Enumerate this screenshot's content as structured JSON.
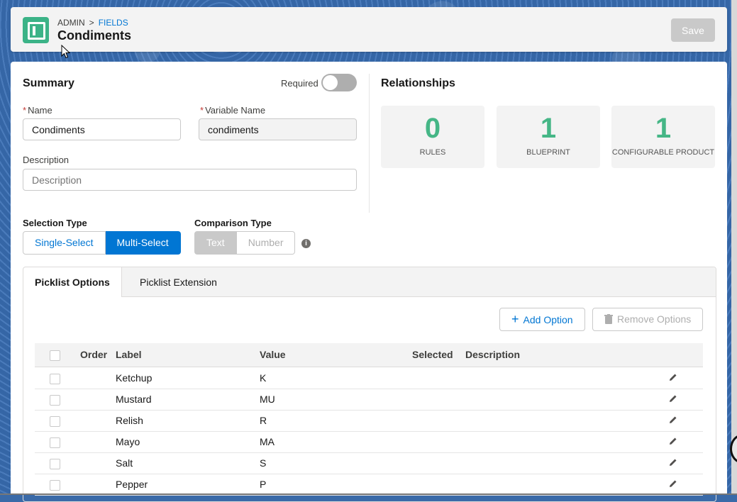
{
  "header": {
    "breadcrumb_root": "ADMIN",
    "breadcrumb_sep": ">",
    "breadcrumb_link": "FIELDS",
    "title": "Condiments",
    "save_label": "Save"
  },
  "summary": {
    "title": "Summary",
    "required_label": "Required",
    "required_on": false,
    "name_label": "Name",
    "name_value": "Condiments",
    "variable_label": "Variable Name",
    "variable_value": "condiments",
    "description_label": "Description",
    "description_placeholder": "Description",
    "required_marker": "*"
  },
  "relationships": {
    "title": "Relationships",
    "stats": [
      {
        "value": "0",
        "caption": "RULES"
      },
      {
        "value": "1",
        "caption": "BLUEPRINT"
      },
      {
        "value": "1",
        "caption": "CONFIGURABLE PRODUCT"
      }
    ]
  },
  "selection_type": {
    "label": "Selection Type",
    "options": [
      "Single-Select",
      "Multi-Select"
    ],
    "selected": "Multi-Select"
  },
  "comparison_type": {
    "label": "Comparison Type",
    "options": [
      "Text",
      "Number"
    ],
    "selected": "Text"
  },
  "tabs": [
    {
      "label": "Picklist Options",
      "active": true
    },
    {
      "label": "Picklist Extension",
      "active": false
    }
  ],
  "actions": {
    "add_label": "Add Option",
    "remove_label": "Remove Options"
  },
  "table": {
    "columns": [
      "Order",
      "Label",
      "Value",
      "Selected",
      "Description"
    ],
    "rows": [
      {
        "label": "Ketchup",
        "value": "K"
      },
      {
        "label": "Mustard",
        "value": "MU"
      },
      {
        "label": "Relish",
        "value": "R"
      },
      {
        "label": "Mayo",
        "value": "MA"
      },
      {
        "label": "Salt",
        "value": "S"
      },
      {
        "label": "Pepper",
        "value": "P"
      }
    ]
  },
  "colors": {
    "brand_green": "#3bb387",
    "accent_blue": "#0176d3",
    "stat_green": "#45b686"
  }
}
